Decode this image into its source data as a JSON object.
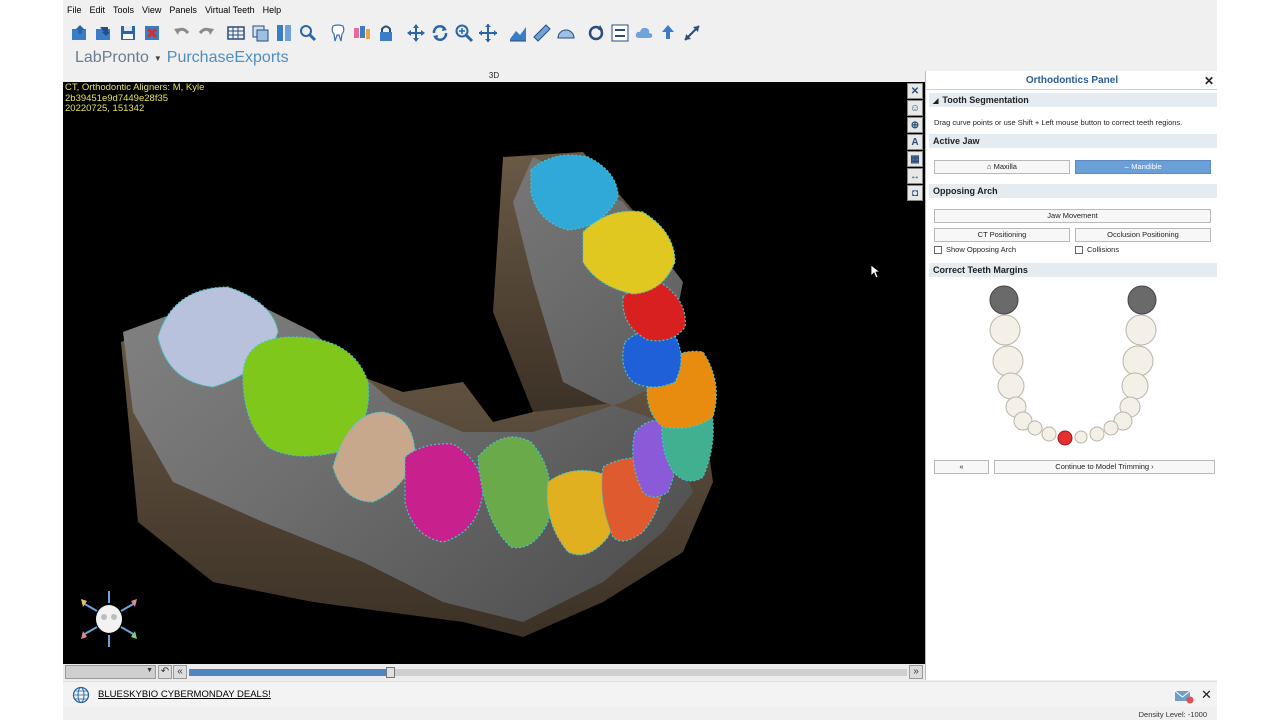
{
  "menu": [
    "File",
    "Edit",
    "Tools",
    "View",
    "Panels",
    "Virtual Teeth",
    "Help"
  ],
  "toolbar_icons": [
    "open-icon",
    "import-icon",
    "save-icon",
    "close-file-icon",
    "undo-icon",
    "redo-icon",
    "grid-icon",
    "layers-icon",
    "measure-icon",
    "zoom-search-icon",
    "tooth-icon",
    "teeth-group-icon",
    "lock-icon",
    "pan-icon",
    "rotate-icon",
    "zoom-icon",
    "move-icon",
    "section-icon",
    "ruler-icon",
    "protractor-icon",
    "refresh-icon",
    "align-icon",
    "cloud-icon",
    "upload-icon",
    "expand-icon"
  ],
  "brand": {
    "left": "LabPronto",
    "right": "PurchaseExports"
  },
  "viewport": {
    "label": "3D",
    "info_lines": [
      "CT, Orthodontic Aligners: M, Kyle",
      "2b39451e9d7449e28f35",
      "20220725, 151342"
    ]
  },
  "side_tools": [
    "close-view-icon",
    "skull-icon",
    "globe-icon",
    "text-a-icon",
    "grid-view-icon",
    "width-arrows-icon",
    "camera-icon"
  ],
  "timeline": {
    "progress": 0.28
  },
  "panel": {
    "title": "Orthodontics Panel",
    "tooth_segmentation": {
      "title": "Tooth Segmentation",
      "hint": "Drag curve points or use Shift + Left mouse button to correct teeth regions."
    },
    "active_jaw": {
      "title": "Active Jaw",
      "maxilla": "Maxilla",
      "mandible": "Mandible",
      "selected": "Mandible"
    },
    "opposing_arch": {
      "title": "Opposing Arch",
      "jaw_movement": "Jaw Movement",
      "ct_positioning": "CT Positioning",
      "occlusion_positioning": "Occlusion Positioning",
      "show_opposing": "Show Opposing Arch",
      "collisions": "Collisions"
    },
    "correct_margins": {
      "title": "Correct Teeth Margins"
    },
    "nav": {
      "back": "«",
      "continue": "Continue to Model Trimming"
    }
  },
  "ad": {
    "text": "BLUESKYBIO CYBERMONDAY DEALS!"
  },
  "status": {
    "density": "Density Level: -1000"
  },
  "colors": {
    "panel_title": "#2b5b96",
    "accent_blue": "#6b9fd8",
    "info_text": "#e6e25a",
    "margin_line": "#3fc9c9"
  }
}
